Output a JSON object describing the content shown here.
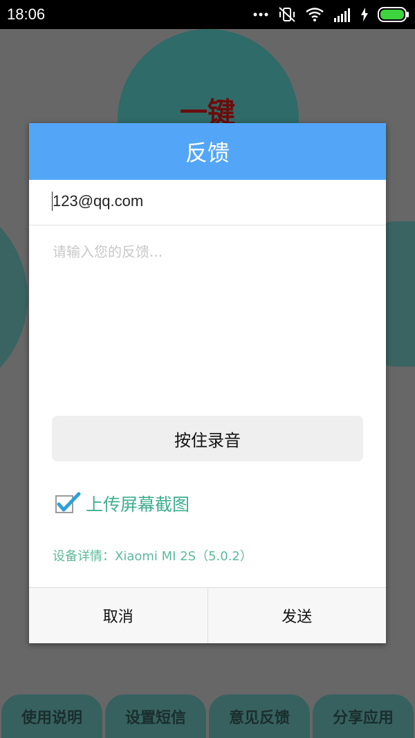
{
  "status_bar": {
    "time": "18:06",
    "icons": [
      "more-dots-icon",
      "vibrate-off-icon",
      "wifi-icon",
      "signal-icon",
      "charging-icon",
      "battery-icon"
    ]
  },
  "background_app": {
    "title": "一键",
    "nav": [
      {
        "label": "使用说明"
      },
      {
        "label": "设置短信"
      },
      {
        "label": "意见反馈"
      },
      {
        "label": "分享应用"
      }
    ],
    "colors": {
      "circle": "#2f6b68",
      "title": "#6b0c0c"
    }
  },
  "dialog": {
    "title": "反馈",
    "email_value": "123@qq.com",
    "feedback_placeholder": "请输入您的反馈...",
    "record_button": "按住录音",
    "upload_screenshot": {
      "label": "上传屏幕截图",
      "checked": true
    },
    "device_info": "设备详情：Xiaomi MI 2S（5.0.2）",
    "cancel_button": "取消",
    "send_button": "发送",
    "colors": {
      "header": "#53a6f7",
      "accent": "#3fae8d"
    }
  }
}
